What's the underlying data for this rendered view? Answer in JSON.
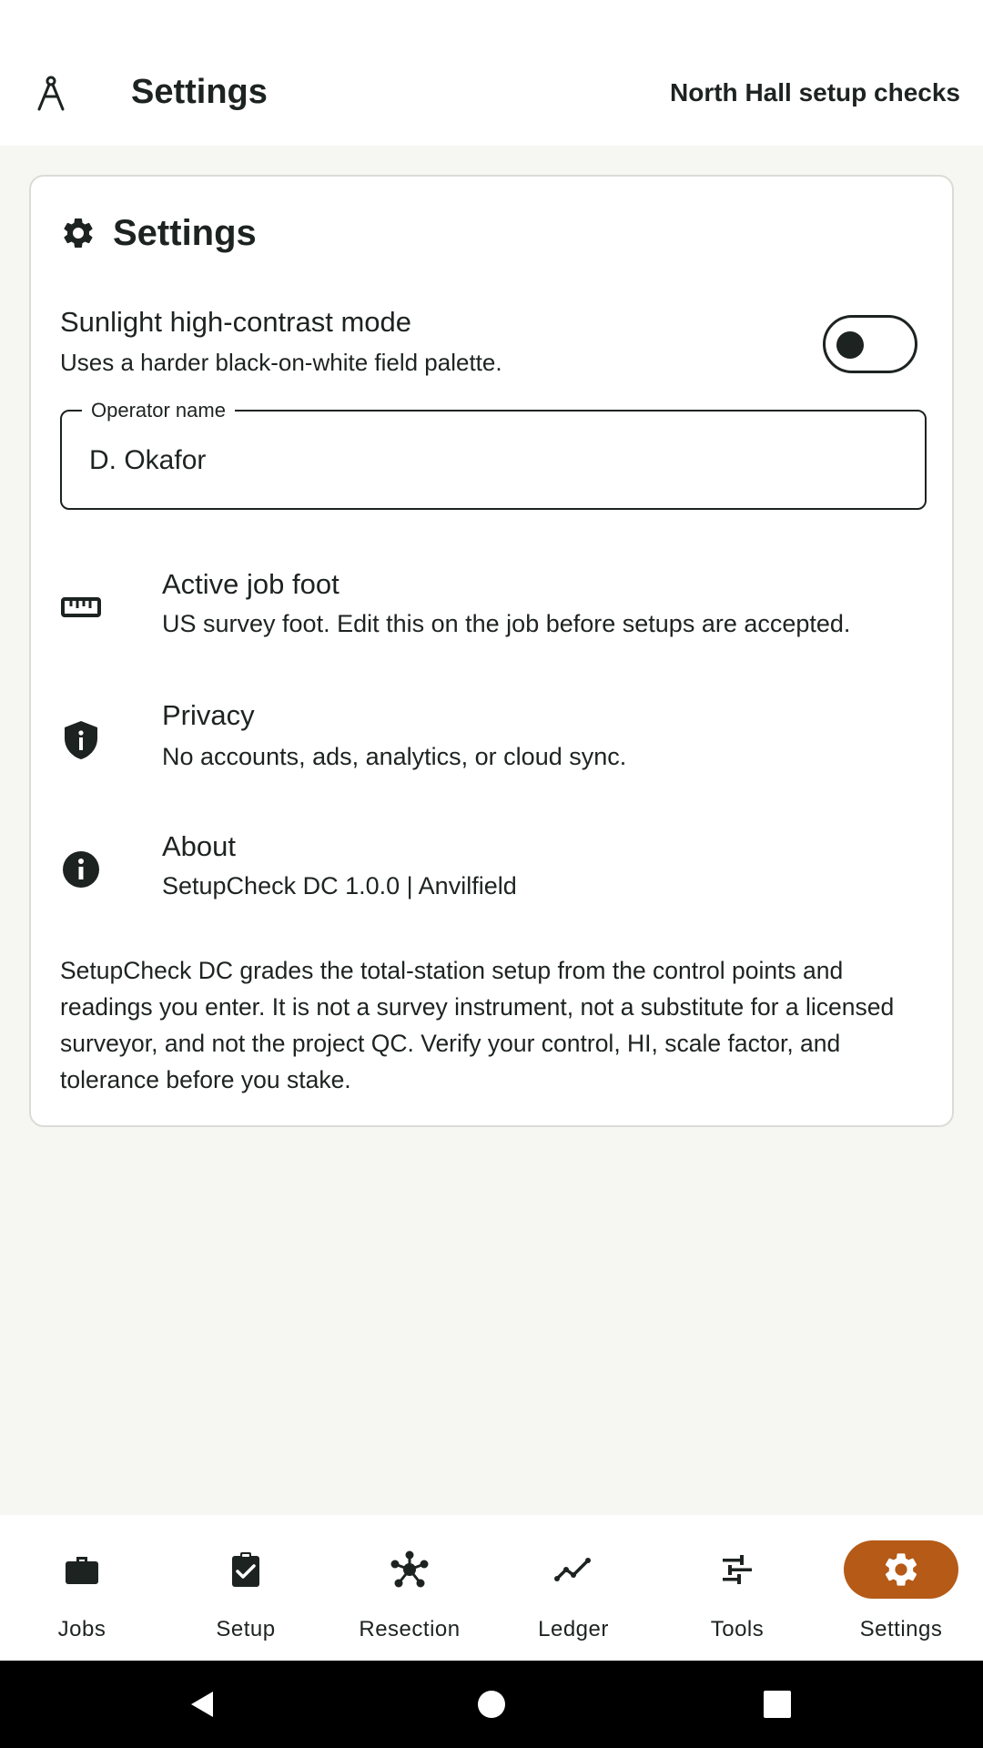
{
  "header": {
    "title": "Settings",
    "job_name": "North Hall setup checks"
  },
  "card": {
    "title": "Settings",
    "sunlight": {
      "label": "Sunlight high-contrast mode",
      "description": "Uses a harder black-on-white field palette.",
      "enabled": false
    },
    "operator": {
      "label": "Operator name",
      "value": "D. Okafor"
    },
    "rows": [
      {
        "icon": "ruler-icon",
        "title": "Active job foot",
        "subtitle": "US survey foot. Edit this on the job before setups are accepted."
      },
      {
        "icon": "shield-info-icon",
        "title": "Privacy",
        "subtitle": "No accounts, ads, analytics, or cloud sync."
      },
      {
        "icon": "info-icon",
        "title": "About",
        "subtitle": "SetupCheck DC 1.0.0 | Anvilfield"
      }
    ],
    "disclaimer": "SetupCheck DC grades the total-station setup from the control points and readings you enter. It is not a survey instrument, not a substitute for a licensed surveyor, and not the project QC. Verify your control, HI, scale factor, and tolerance before you stake."
  },
  "nav": {
    "items": [
      {
        "label": "Jobs",
        "icon": "briefcase-icon"
      },
      {
        "label": "Setup",
        "icon": "clipboard-check-icon"
      },
      {
        "label": "Resection",
        "icon": "hub-icon"
      },
      {
        "label": "Ledger",
        "icon": "line-chart-icon"
      },
      {
        "label": "Tools",
        "icon": "sliders-icon"
      },
      {
        "label": "Settings",
        "icon": "gear-icon"
      }
    ],
    "active": "Settings"
  },
  "colors": {
    "accent": "#b55a17",
    "text": "#1d2320",
    "background": "#f6f6f2",
    "surface": "#ffffff"
  }
}
